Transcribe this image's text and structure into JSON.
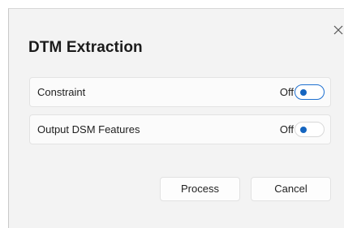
{
  "dialog": {
    "title": "DTM Extraction",
    "close_icon": "close-icon"
  },
  "rows": [
    {
      "label": "Constraint",
      "state_text": "Off",
      "toggle_on": false,
      "focused": true
    },
    {
      "label": "Output DSM Features",
      "state_text": "Off",
      "toggle_on": false,
      "focused": false
    }
  ],
  "buttons": {
    "process_label": "Process",
    "cancel_label": "Cancel"
  },
  "colors": {
    "accent": "#1565c0",
    "focus_border": "#1d6fd0",
    "dialog_bg": "#f3f3f3"
  }
}
